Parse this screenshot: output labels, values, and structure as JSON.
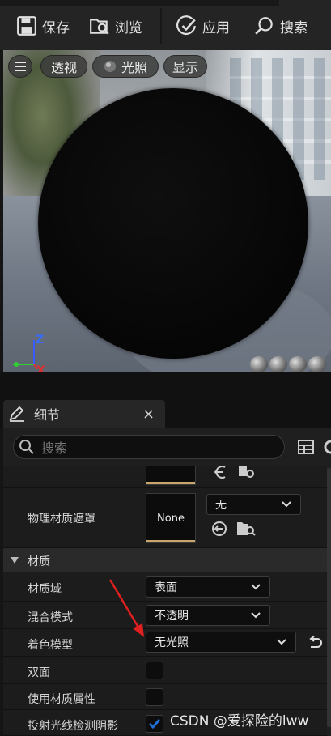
{
  "toolbar": {
    "save_label": "保存",
    "browse_label": "浏览",
    "apply_label": "应用",
    "search_label": "搜索"
  },
  "viewport": {
    "menu_icon": "hamburger-icon",
    "perspective_label": "透视",
    "lighting_label": "光照",
    "show_label": "显示",
    "axis_z": "Z",
    "axis_x": "X"
  },
  "details": {
    "tab_title": "细节",
    "close_glyph": "×",
    "search_placeholder": "搜索",
    "phys_mask_label": "物理材质遮罩",
    "phys_mask_thumb": "None",
    "phys_mask_value": "无",
    "section_material": "材质",
    "rows": [
      {
        "label": "材质域",
        "value": "表面"
      },
      {
        "label": "混合模式",
        "value": "不透明"
      },
      {
        "label": "着色模型",
        "value": "无光照"
      },
      {
        "label": "双面",
        "checked": false
      },
      {
        "label": "使用材质属性",
        "checked": false
      },
      {
        "label": "投射光线检测阴影",
        "checked": true
      }
    ]
  },
  "watermark": "CSDN @爱探险的lww",
  "colors": {
    "accent_blue": "#1e6fd9",
    "annotation_red": "#e02020",
    "thumb_gold": "#c9a66b"
  }
}
